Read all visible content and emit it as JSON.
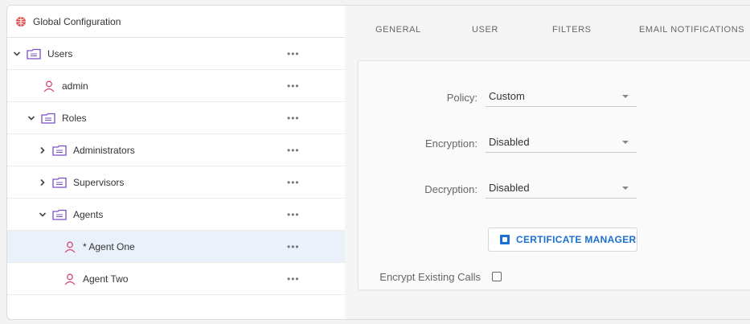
{
  "tree": {
    "root_label": "Global Configuration",
    "rows": [
      {
        "label": "Users",
        "type": "folder",
        "expanded": true,
        "level": 0
      },
      {
        "label": "admin",
        "type": "user",
        "level": 1
      },
      {
        "label": "Roles",
        "type": "folder",
        "expanded": true,
        "level": 1
      },
      {
        "label": "Administrators",
        "type": "folder",
        "expanded": false,
        "level": 2
      },
      {
        "label": "Supervisors",
        "type": "folder",
        "expanded": false,
        "level": 2
      },
      {
        "label": "Agents",
        "type": "folder",
        "expanded": true,
        "level": 2
      },
      {
        "label": "* Agent One",
        "type": "user",
        "level": 3,
        "selected": true
      },
      {
        "label": "Agent Two",
        "type": "user",
        "level": 3
      }
    ],
    "more_label": "•••"
  },
  "tabs": [
    "GENERAL",
    "USER",
    "FILTERS",
    "EMAIL NOTIFICATIONS"
  ],
  "form": {
    "policy_label": "Policy:",
    "policy_value": "Custom",
    "encryption_label": "Encryption:",
    "encryption_value": "Disabled",
    "decryption_label": "Decryption:",
    "decryption_value": "Disabled",
    "cert_button": "CERTIFICATE MANAGER",
    "encrypt_calls_label": "Encrypt Existing Calls",
    "encrypt_calls_checked": false
  },
  "colors": {
    "accent": "#1b6fd1",
    "user_icon": "#d64a7a",
    "folder_icon": "#7a4fc4",
    "selected_row": "#eaf1fb"
  }
}
